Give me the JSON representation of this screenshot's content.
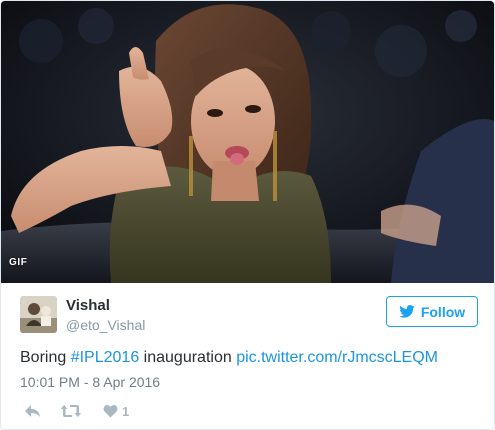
{
  "media": {
    "badge": "GIF"
  },
  "author": {
    "name": "Vishal",
    "handle": "@eto_Vishal"
  },
  "follow_button": {
    "label": "Follow"
  },
  "tweet": {
    "text_before": "Boring ",
    "hashtag": "#IPL2016",
    "text_middle": " inauguration ",
    "link": "pic.twitter.com/rJmcscLEQM",
    "timestamp": "10:01 PM - 8 Apr 2016"
  },
  "actions": {
    "like_count": "1"
  },
  "colors": {
    "brand_blue": "#1da1f2",
    "link_blue": "#1b95e0",
    "text_primary": "#292f33",
    "text_secondary": "#8899a6",
    "icon_gray": "#aab8c2"
  }
}
